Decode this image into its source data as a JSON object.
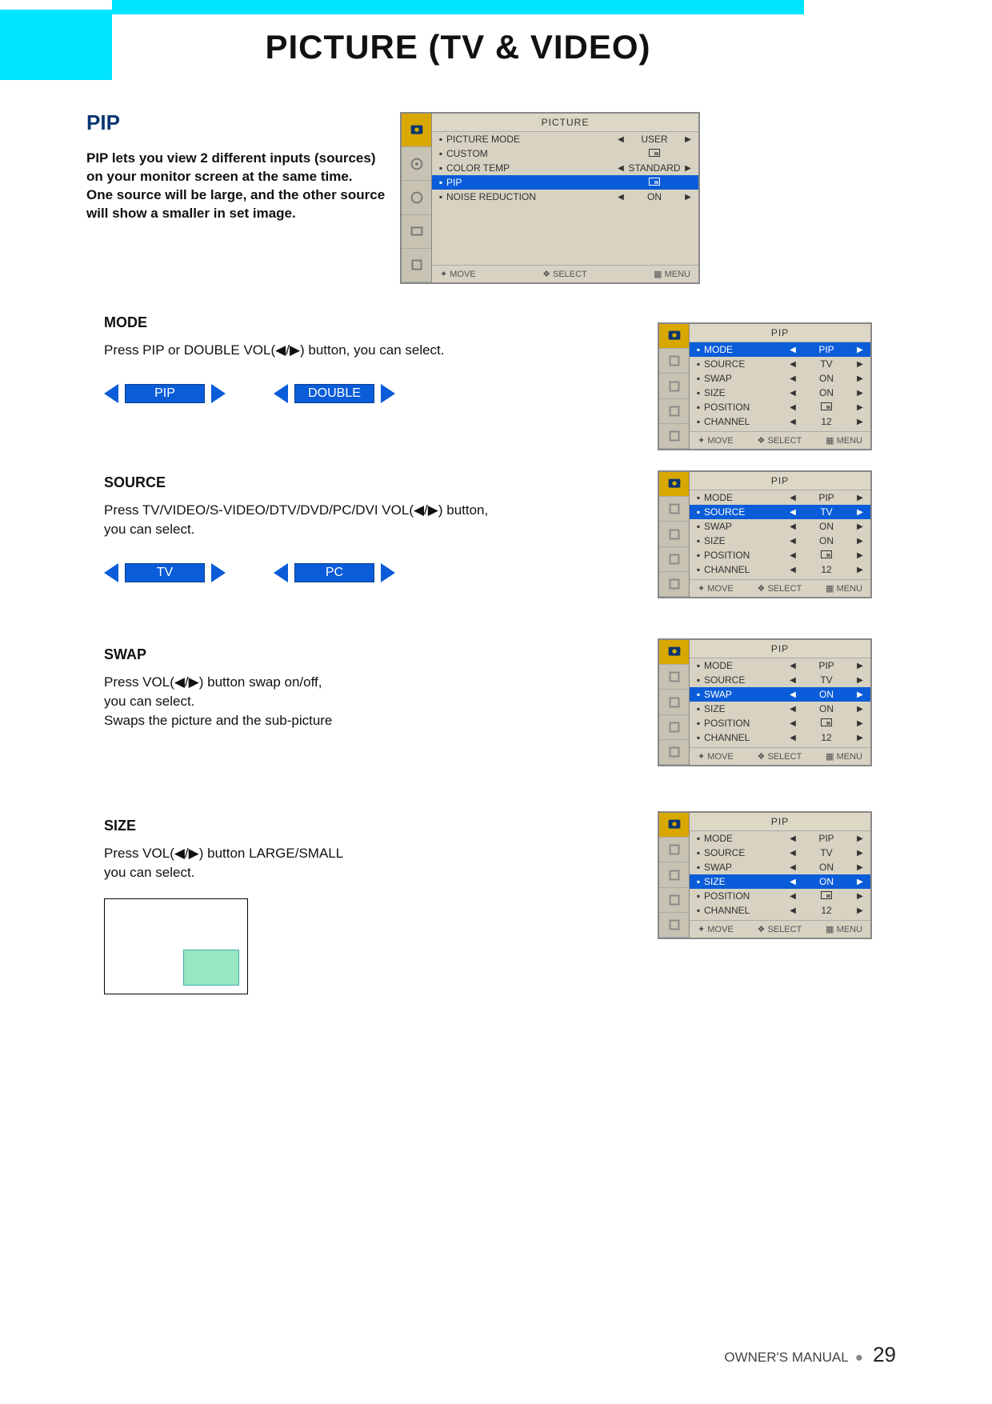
{
  "page_title": "PICTURE (TV & VIDEO)",
  "footer": {
    "label": "OWNER'S MANUAL",
    "bullet": "●",
    "page": "29"
  },
  "pip": {
    "heading": "PIP",
    "intro_l1": "PIP lets you view 2 different inputs (sources)",
    "intro_l2": "on your monitor screen at the same time.",
    "intro_l3": "One source will be large, and the other source",
    "intro_l4": "will show a smaller in set image."
  },
  "mode": {
    "heading": "MODE",
    "text": "Press PIP or DOUBLE VOL(◀/▶) button, you can select.",
    "opt1": "PIP",
    "opt2": "DOUBLE"
  },
  "source": {
    "heading": "SOURCE",
    "text_l1": "Press TV/VIDEO/S-VIDEO/DTV/DVD/PC/DVI VOL(◀/▶) button,",
    "text_l2": "you can select.",
    "opt1": "TV",
    "opt2": "PC"
  },
  "swap": {
    "heading": "SWAP",
    "text_l1": "Press  VOL(◀/▶) button swap on/off,",
    "text_l2": "you can select.",
    "text_l3": "Swaps the picture and the sub-picture"
  },
  "size": {
    "heading": "SIZE",
    "text_l1": "Press  VOL(◀/▶) button LARGE/SMALL",
    "text_l2": "you can select."
  },
  "osd_footer": {
    "move": "MOVE",
    "select": "SELECT",
    "menu": "MENU"
  },
  "osd_picture": {
    "title": "PICTURE",
    "rows": [
      {
        "label": "PICTURE MODE",
        "value": "USER",
        "arrows": true
      },
      {
        "label": "CUSTOM",
        "value": "",
        "icon": true
      },
      {
        "label": "COLOR TEMP",
        "value": "STANDARD",
        "arrows": true
      },
      {
        "label": "PIP",
        "value": "",
        "icon": true,
        "hl": true
      },
      {
        "label": "NOISE REDUCTION",
        "value": "ON",
        "arrows": true
      }
    ]
  },
  "osd_pip_common": {
    "title": "PIP",
    "rows": [
      {
        "label": "MODE",
        "value": "PIP"
      },
      {
        "label": "SOURCE",
        "value": "TV"
      },
      {
        "label": "SWAP",
        "value": "ON"
      },
      {
        "label": "SIZE",
        "value": "ON"
      },
      {
        "label": "POSITION",
        "value": "",
        "icon": true
      },
      {
        "label": "CHANNEL",
        "value": "12"
      }
    ]
  },
  "highlights": {
    "mode": 0,
    "source": 1,
    "swap": 2,
    "size": 3
  }
}
